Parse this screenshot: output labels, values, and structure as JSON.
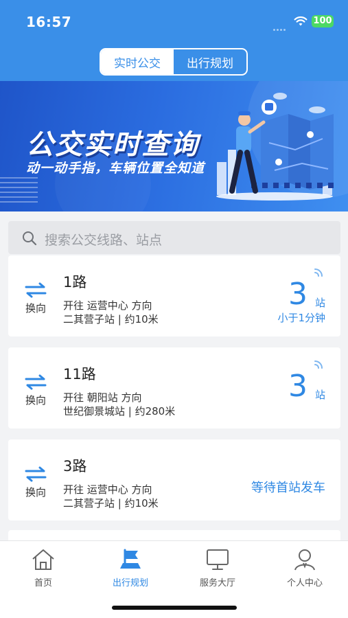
{
  "status_bar": {
    "time": "16:57",
    "battery": "100"
  },
  "segment_tabs": [
    {
      "label": "实时公交",
      "active": true
    },
    {
      "label": "出行规划",
      "active": false
    }
  ],
  "banner": {
    "title": "公交实时查询",
    "subtitle": "动一动手指，车辆位置全知道"
  },
  "search": {
    "placeholder": "搜索公交线路、站点"
  },
  "swap_label": "换向",
  "routes": [
    {
      "name": "1路",
      "direction": "开往 运营中心 方向",
      "stop": "二其营子站 | 约10米",
      "count": "3",
      "unit": "站",
      "eta": "小于1分钟"
    },
    {
      "name": "11路",
      "direction": "开往 朝阳站 方向",
      "stop": "世纪御景城站 | 约280米",
      "count": "3",
      "unit": "站",
      "eta": ""
    },
    {
      "name": "3路",
      "direction": "开往 运营中心 方向",
      "stop": "二其营子站 | 约10米",
      "waiting": "等待首站发车"
    }
  ],
  "tabbar": [
    {
      "label": "首页",
      "icon": "home-icon",
      "active": false
    },
    {
      "label": "出行规划",
      "icon": "flag-icon",
      "active": true
    },
    {
      "label": "服务大厅",
      "icon": "monitor-icon",
      "active": false
    },
    {
      "label": "个人中心",
      "icon": "user-icon",
      "active": false
    }
  ],
  "colors": {
    "primary": "#3a8fe8",
    "accent": "#2f88e3",
    "battery": "#4cd964"
  }
}
